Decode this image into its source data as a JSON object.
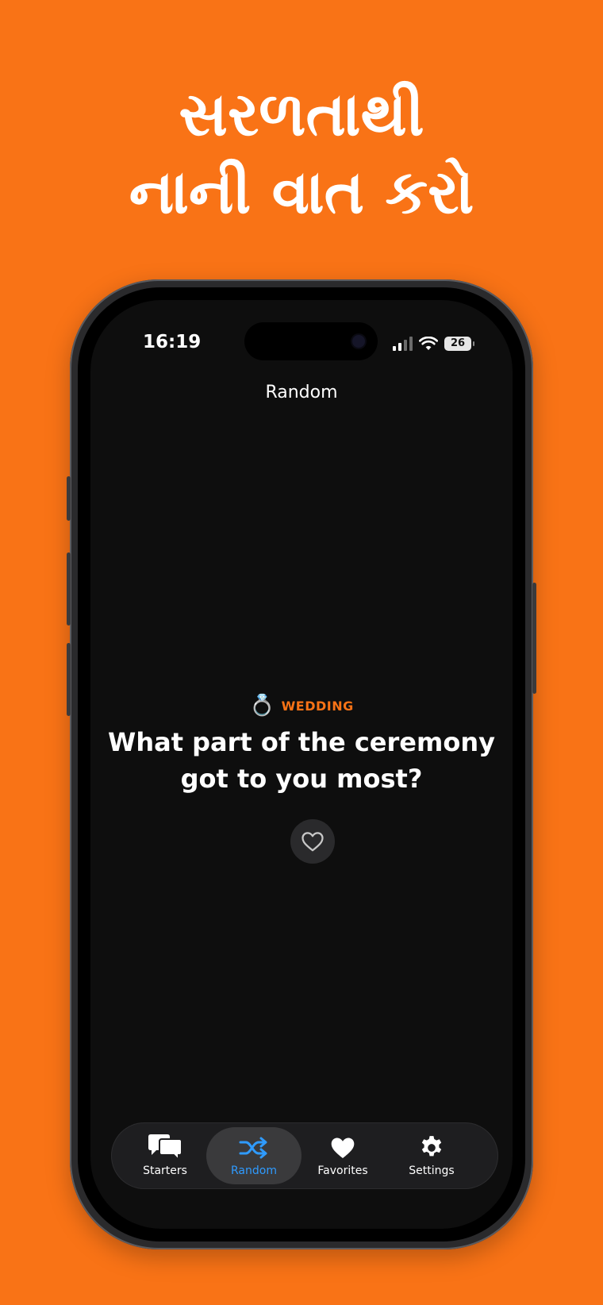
{
  "headline": {
    "line1": "સરળતાથી",
    "line2": "નાની વાત કરો"
  },
  "status_bar": {
    "time": "16:19",
    "battery": "26"
  },
  "nav": {
    "title": "Random"
  },
  "card": {
    "category_emoji": "💍",
    "category": "WEDDING",
    "question": "What part of the ceremony got to you most?",
    "favorite_icon": "heart-outline-icon"
  },
  "tabbar": {
    "items": [
      {
        "label": "Starters",
        "icon": "chat-bubbles-icon",
        "active": false
      },
      {
        "label": "Random",
        "icon": "shuffle-icon",
        "active": true
      },
      {
        "label": "Favorites",
        "icon": "heart-icon",
        "active": false
      },
      {
        "label": "Settings",
        "icon": "gear-icon",
        "active": false
      }
    ]
  },
  "colors": {
    "background": "#F97316",
    "screen": "#0e0e0e",
    "accent_category": "#F97316",
    "accent_tab": "#2f9bff"
  }
}
